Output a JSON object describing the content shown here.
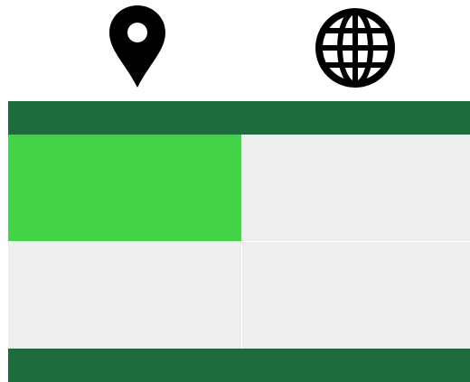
{
  "icons": [
    {
      "name": "map-pin-icon"
    },
    {
      "name": "globe-icon"
    }
  ],
  "colors": {
    "bar": "#1e6b3e",
    "cell_selected": "#44d348",
    "cell_default": "#eeeeee",
    "icon": "#000000"
  },
  "grid": {
    "rows": 2,
    "columns": 2,
    "cells": [
      {
        "selected": true
      },
      {
        "selected": false
      },
      {
        "selected": false
      },
      {
        "selected": false
      }
    ]
  }
}
